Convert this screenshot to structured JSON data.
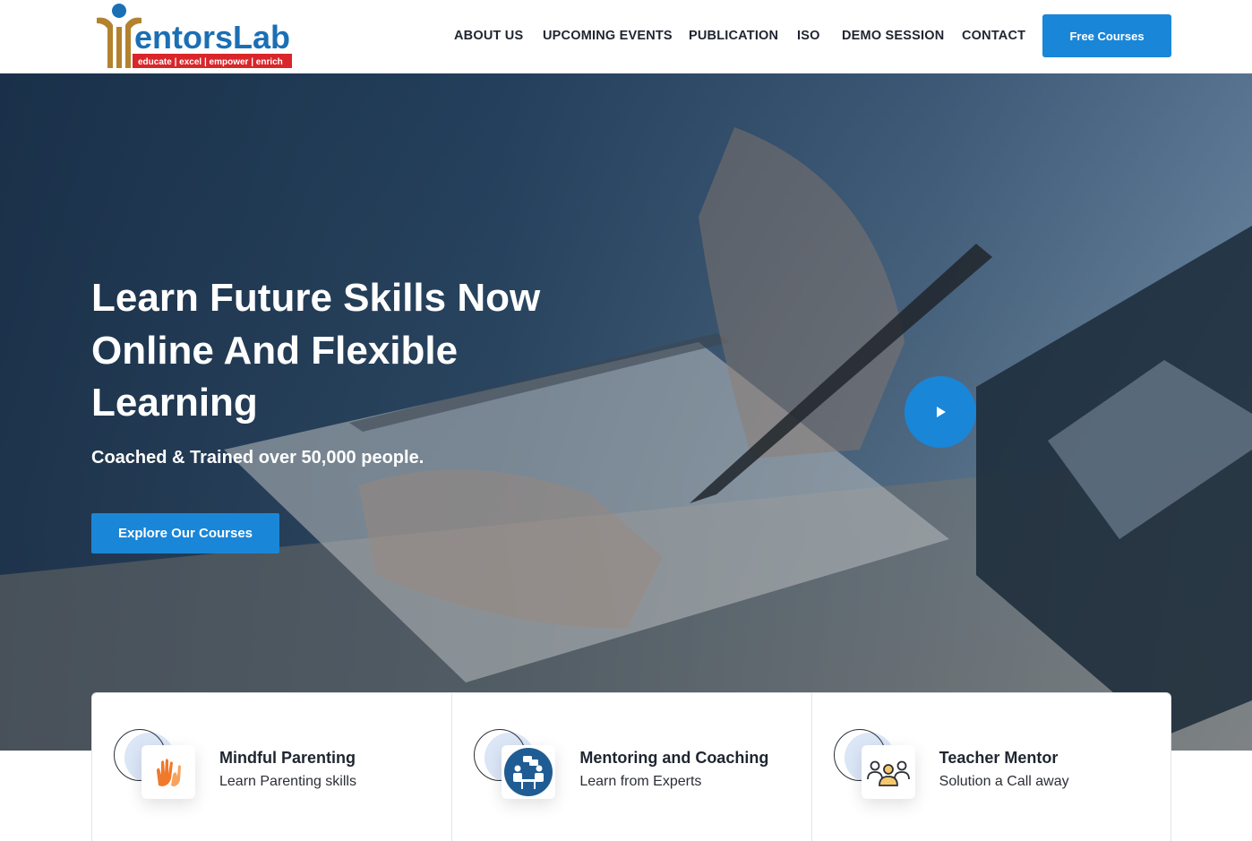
{
  "brand": {
    "logo_text": "MentorsLab",
    "tagline": "educate | excel | empower | enrich"
  },
  "nav": {
    "items": [
      {
        "label": "ABOUT US"
      },
      {
        "label": "UPCOMING EVENTS"
      },
      {
        "label": "PUBLICATION"
      },
      {
        "label": "ISO"
      },
      {
        "label": "DEMO SESSION"
      },
      {
        "label": "CONTACT"
      }
    ],
    "cta_label": "Free Courses"
  },
  "hero": {
    "title_line1": "Learn Future Skills Now",
    "title_line2": "Online And Flexible",
    "title_line3": "Learning",
    "subtitle": "Coached & Trained over 50,000 people.",
    "cta_label": "Explore Our Courses",
    "play_icon": "play-icon"
  },
  "features": [
    {
      "title": "Mindful Parenting",
      "subtitle": "Learn Parenting skills",
      "icon": "hands-icon"
    },
    {
      "title": "Mentoring and Coaching",
      "subtitle": "Learn from Experts",
      "icon": "meeting-icon"
    },
    {
      "title": "Teacher Mentor",
      "subtitle": "Solution a Call away",
      "icon": "group-icon"
    }
  ],
  "colors": {
    "accent": "#1a86d8",
    "logo_gold": "#b3822f",
    "logo_blue": "#1b6fb5",
    "logo_red": "#d9262a"
  }
}
